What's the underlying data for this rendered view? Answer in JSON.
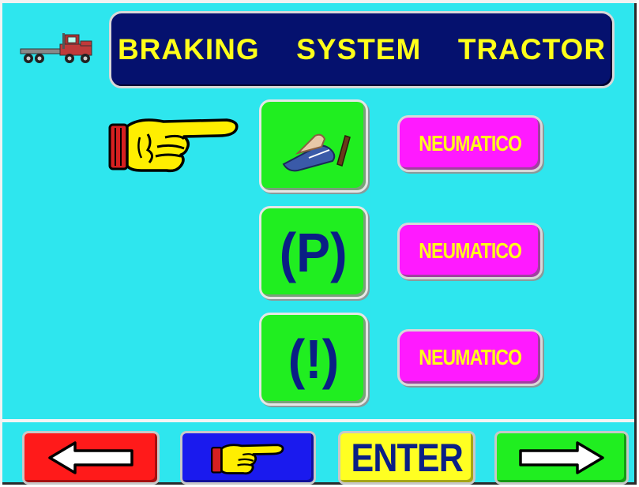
{
  "header": {
    "title": "BRAKING  SYSTEM  TRACTOR"
  },
  "icon_buttons": [
    {
      "name": "foot-brake-pedal-icon",
      "symbol": ""
    },
    {
      "name": "parking-brake",
      "symbol": "(P)"
    },
    {
      "name": "brake-warning",
      "symbol": "(!)"
    }
  ],
  "modes": [
    {
      "label": "NEUMATICO"
    },
    {
      "label": "NEUMATICO"
    },
    {
      "label": "NEUMATICO"
    }
  ],
  "footer": {
    "enter_label": "ENTER"
  },
  "colors": {
    "background": "#2ee6ee",
    "title_bg": "#05116e",
    "title_text": "#ffff1a",
    "icon_button": "#20ee20",
    "mode_button": "#ff1aff",
    "back": "#ff1a1a",
    "menu": "#1a1aee",
    "enter": "#ffff22",
    "next": "#20ee20"
  },
  "icons": [
    "truck-icon",
    "pointing-hand-icon",
    "foot-brake-pedal-icon",
    "left-arrow-icon",
    "right-arrow-icon"
  ]
}
